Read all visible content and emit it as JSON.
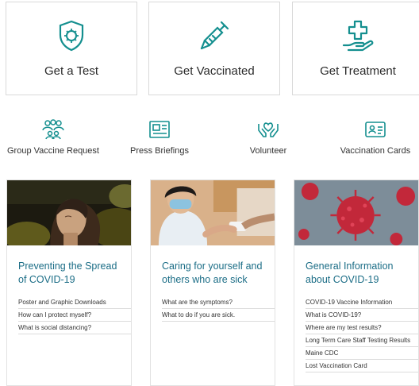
{
  "colors": {
    "teal": "#148f8f",
    "link_title": "#1b6d86"
  },
  "actions": [
    {
      "label": "Get a Test",
      "icon": "shield-virus-icon"
    },
    {
      "label": "Get Vaccinated",
      "icon": "syringe-icon"
    },
    {
      "label": "Get Treatment",
      "icon": "hand-medical-cross-icon"
    }
  ],
  "quick_links": [
    {
      "label": "Group Vaccine Request",
      "icon": "group-people-icon"
    },
    {
      "label": "Press Briefings",
      "icon": "newspaper-icon"
    },
    {
      "label": "Volunteer",
      "icon": "hands-heart-icon"
    },
    {
      "label": "Vaccination Cards",
      "icon": "id-card-icon"
    }
  ],
  "columns": [
    {
      "title": "Preventing the Spread of COVID-19",
      "image": "woman-breathing-photo",
      "links": [
        "Poster and Graphic Downloads",
        "How can I protect myself?",
        "What is social distancing?"
      ]
    },
    {
      "title": "Caring for yourself and others who are sick",
      "image": "child-mask-sanitizer-photo",
      "links": [
        "What are the symptoms?",
        "What to do if you are sick."
      ]
    },
    {
      "title": "General Information about COVID-19",
      "image": "coronavirus-particles-photo",
      "links": [
        "COVID-19 Vaccine Information",
        "What is COVID-19?",
        "Where are my test results?",
        "Long Term Care Staff Testing Results",
        "Maine CDC",
        "Lost Vaccination Card"
      ]
    }
  ]
}
